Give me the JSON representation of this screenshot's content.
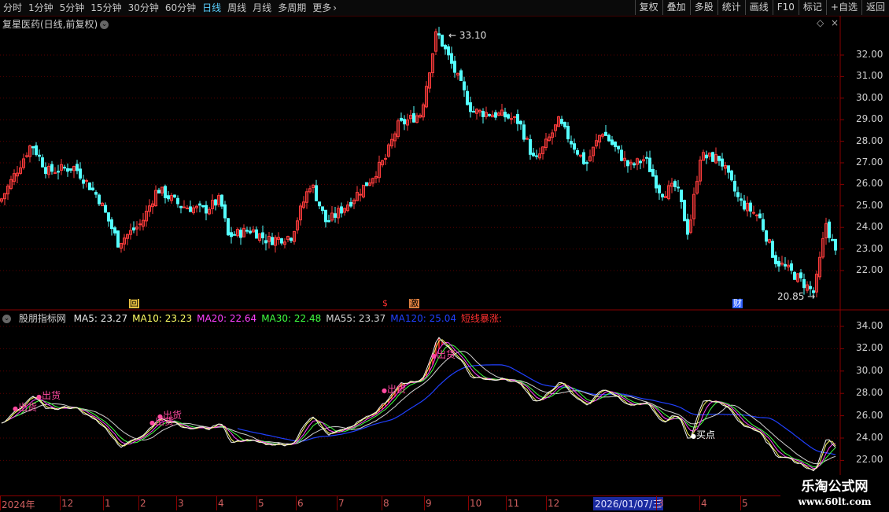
{
  "toolbar": {
    "periods": [
      "分时",
      "1分钟",
      "5分钟",
      "15分钟",
      "30分钟",
      "60分钟",
      "日线",
      "周线",
      "月线",
      "多周期",
      "更多"
    ],
    "active_period": "日线",
    "more_icon": "chevron-right-icon",
    "buttons": [
      "复权",
      "叠加",
      "多股",
      "统计",
      "画线",
      "F10",
      "标记",
      "+自选",
      "返回"
    ]
  },
  "main_chart": {
    "title": "复星医药(日线,前复权)",
    "dropdown_icon": "chevron-down-icon",
    "y_ticks": [
      "32.00",
      "31.00",
      "30.00",
      "29.00",
      "28.00",
      "27.00",
      "26.00",
      "25.00",
      "24.00",
      "23.00",
      "22.00"
    ],
    "high_label": "33.10",
    "low_label": "20.85",
    "markers": {
      "hui": "回",
      "dollar": "$",
      "ji": "激",
      "cai": "财"
    },
    "colors": {
      "up": "#ff3c3c",
      "down": "#54ffff"
    }
  },
  "indicator": {
    "name": "股朋指标网",
    "items": [
      {
        "label": "MA5: 23.27",
        "color": "#e8e8e8"
      },
      {
        "label": "MA10: 23.23",
        "color": "#ffff66"
      },
      {
        "label": "MA20: 22.64",
        "color": "#ff40ff"
      },
      {
        "label": "MA30: 22.48",
        "color": "#40ff40"
      },
      {
        "label": "MA55: 23.37",
        "color": "#d0d0d0"
      },
      {
        "label": "MA120: 25.04",
        "color": "#2040ff"
      },
      {
        "label": "短线暴涨:",
        "color": "#ff3030"
      }
    ],
    "y_ticks": [
      "34.00",
      "32.00",
      "30.00",
      "28.00",
      "26.00",
      "24.00",
      "22.00"
    ],
    "annotations": {
      "sell": "出货",
      "buy": "买点"
    }
  },
  "date_axis": {
    "labels": [
      "2024年",
      "12",
      "1",
      "2",
      "3",
      "4",
      "5",
      "6",
      "7",
      "8",
      "9",
      "10",
      "11",
      "12",
      "3",
      "4",
      "5"
    ],
    "selected": "2026/01/07/三"
  },
  "logo": {
    "line1": "乐淘公式网",
    "line2": "www.60lt.com"
  }
}
